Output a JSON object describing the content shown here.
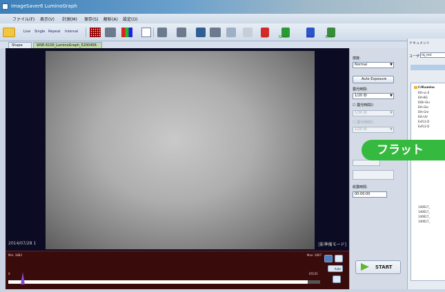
{
  "window": {
    "title": "ImageSaver6 LuminoGraph"
  },
  "menu": [
    "ファイル(F)",
    "表示(V)",
    "計測(M)",
    "保存(S)",
    "解析(A)",
    "設定(O)"
  ],
  "toolbar": {
    "live": "Live",
    "single": "Single",
    "repeat": "Repeat",
    "interval": "Interval",
    "tiff": "TIFF",
    "red": "Red",
    "green": "Green",
    "blue": "Blue",
    "emit": "Emit"
  },
  "tabs": {
    "shape": "Shape",
    "file": "WSE-6100_LuminoGraph_5200406"
  },
  "viewer": {
    "date": "2014/07/28 1",
    "mode": "[影準備モード]"
  },
  "histogram": {
    "min": "Min: 1883",
    "max": "Max: 1807",
    "level_hi": "65535",
    "level_lo": "0",
    "level_val": "1807",
    "level_left": "1283"
  },
  "settings": {
    "sensitivity_label": "感度:",
    "sensitivity_value": "Normal",
    "auto_exposure": "Auto Exposure",
    "exposure_label": "露光時間:",
    "exposure_value": "1/20 秒",
    "exposure2_check": "露光時間2:",
    "exposure2_value": "1/20 秒",
    "exposure3_check": "露光時間3:",
    "exposure3_value": "1/20 秒",
    "total_label": "総露時間:",
    "total_value": "00:00:00",
    "start": "START"
  },
  "auto_button": "Auto",
  "badge": "フラット",
  "document": {
    "header": "ドキュメント",
    "user_label": "ユーザー:",
    "user_value": "tkj_test",
    "tree": [
      "C:¥Lumino",
      "Eth-vs E",
      "Eth-BG",
      "EtDr-Glu",
      "Eth-Glu",
      "Eth-Gre",
      "Eth-UV",
      "ExFLS D",
      "ExFLS D",
      "140617_",
      "140617_",
      "140617_",
      "140617_"
    ]
  }
}
